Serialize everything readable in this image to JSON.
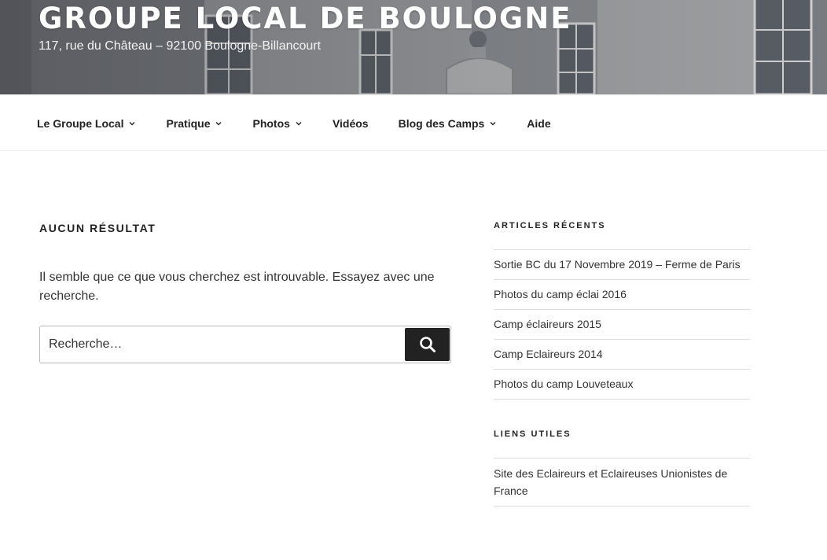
{
  "header": {
    "site_title": "GROUPE LOCAL DE BOULOGNE",
    "site_description": "117, rue du Château – 92100 Boulogne-Billancourt"
  },
  "nav": {
    "items": [
      {
        "label": "Le Groupe Local",
        "has_submenu": true
      },
      {
        "label": "Pratique",
        "has_submenu": true
      },
      {
        "label": "Photos",
        "has_submenu": true
      },
      {
        "label": "Vidéos",
        "has_submenu": false
      },
      {
        "label": "Blog des Camps",
        "has_submenu": true
      },
      {
        "label": "Aide",
        "has_submenu": false
      }
    ]
  },
  "main": {
    "page_title": "AUCUN RÉSULTAT",
    "message": "Il semble que ce que vous cherchez est introuvable. Essayez avec une recherche.",
    "search": {
      "placeholder": "Recherche…",
      "button_icon": "search-icon"
    }
  },
  "sidebar": {
    "recent_posts": {
      "title": "ARTICLES RÉCENTS",
      "items": [
        "Sortie BC du 17 Novembre 2019 – Ferme de Paris",
        "Photos du camp éclai 2016",
        "Camp éclaireurs 2015",
        "Camp Eclaireurs 2014",
        "Photos du camp Louveteaux"
      ]
    },
    "useful_links": {
      "title": "LIENS UTILES",
      "items": [
        "Site des Eclaireurs et Eclaireuses Unionistes de France"
      ]
    }
  },
  "colors": {
    "search_button_bg": "#222222",
    "text": "#333333",
    "divider": "#dddddd"
  }
}
